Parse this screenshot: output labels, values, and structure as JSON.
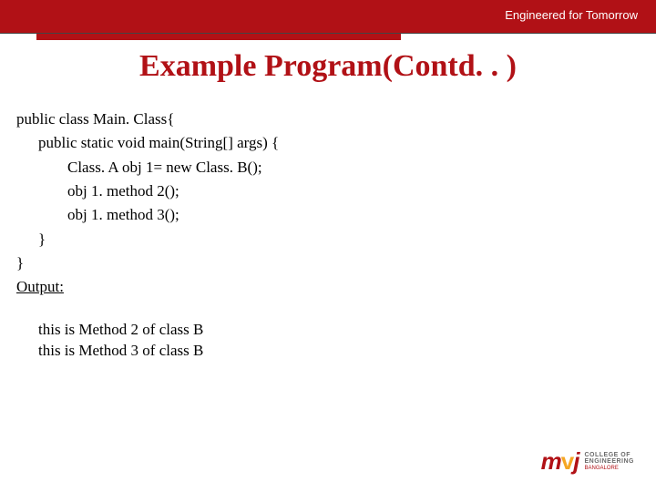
{
  "header": {
    "tagline": "Engineered for Tomorrow"
  },
  "title": "Example Program(Contd. . )",
  "code": {
    "line1": "public class Main. Class{",
    "line2": "public static void main(String[] args) {",
    "line3": "Class. A obj 1= new Class. B();",
    "line4": "obj 1. method 2();",
    "line5": "obj 1. method 3();",
    "line6": "}",
    "line7": "}",
    "outputLabel": "Output:",
    "output1": "this is Method 2 of class B",
    "output2": "this is Method 3 of class B"
  },
  "logo": {
    "mark_prefix": "m",
    "mark_dot": "v",
    "mark_suffix": "j",
    "text1": "COLLEGE OF",
    "text2": "ENGINEERING",
    "sub": "BANGALORE"
  }
}
